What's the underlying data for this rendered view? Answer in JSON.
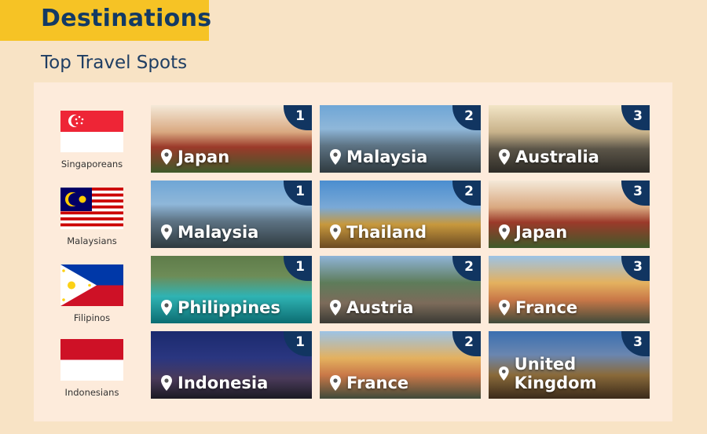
{
  "header": {
    "title": "Destinations",
    "subtitle": "Top Travel Spots"
  },
  "colors": {
    "accent": "#f6c325",
    "navy": "#133a64",
    "background": "#f8e3c5",
    "panel": "#fdebdb"
  },
  "rows": [
    {
      "nationality": "Singaporeans",
      "flag": "singapore-flag",
      "spots": [
        {
          "rank": "1",
          "name": "Japan"
        },
        {
          "rank": "2",
          "name": "Malaysia"
        },
        {
          "rank": "3",
          "name": "Australia"
        }
      ]
    },
    {
      "nationality": "Malaysians",
      "flag": "malaysia-flag",
      "spots": [
        {
          "rank": "1",
          "name": "Malaysia"
        },
        {
          "rank": "2",
          "name": "Thailand"
        },
        {
          "rank": "3",
          "name": "Japan"
        }
      ]
    },
    {
      "nationality": "Filipinos",
      "flag": "philippines-flag",
      "spots": [
        {
          "rank": "1",
          "name": "Philippines"
        },
        {
          "rank": "2",
          "name": "Austria"
        },
        {
          "rank": "3",
          "name": "France"
        }
      ]
    },
    {
      "nationality": "Indonesians",
      "flag": "indonesia-flag",
      "spots": [
        {
          "rank": "1",
          "name": "Indonesia"
        },
        {
          "rank": "2",
          "name": "France"
        },
        {
          "rank": "3",
          "name": "United Kingdom"
        }
      ]
    }
  ]
}
